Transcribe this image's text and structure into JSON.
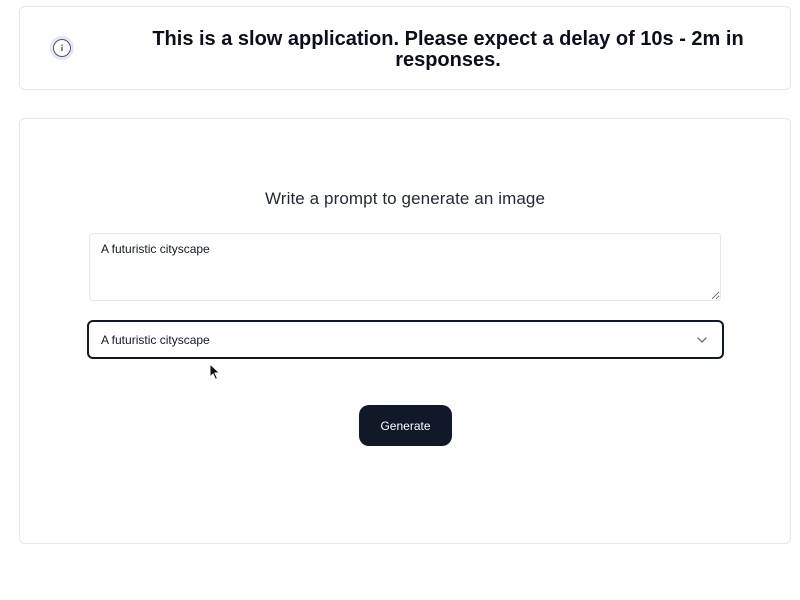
{
  "notice": {
    "icon": "info-icon",
    "text": "This is a slow application. Please expect a delay of 10s - 2m in responses."
  },
  "form": {
    "heading": "Write a prompt to generate an image",
    "textarea_value": "A futuristic cityscape",
    "select_value": "A futuristic cityscape",
    "select_icon": "chevron-down-icon",
    "generate_label": "Generate"
  },
  "colors": {
    "primary_button": "#111827",
    "border": "#e5e7eb"
  }
}
